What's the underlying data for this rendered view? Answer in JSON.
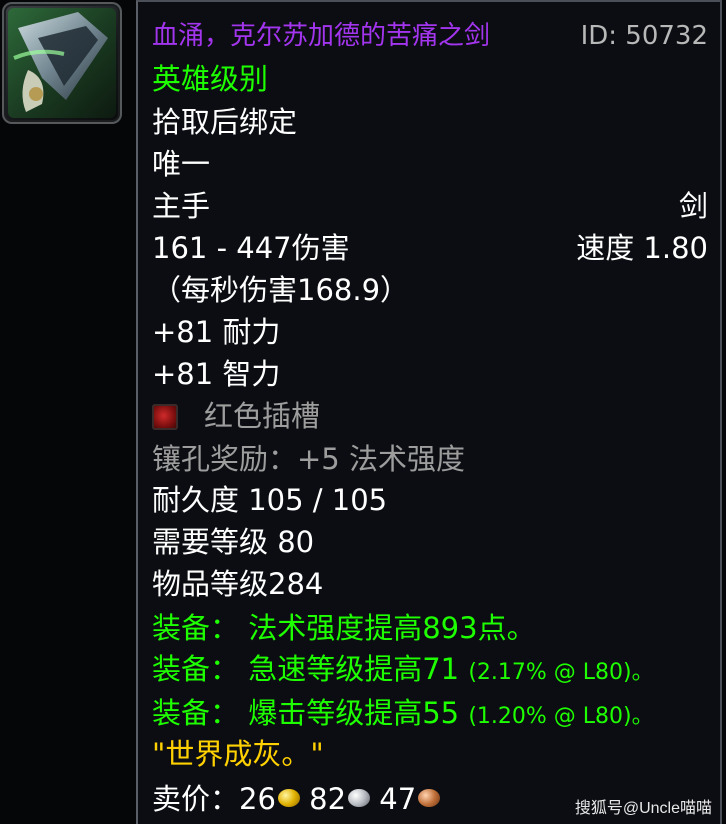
{
  "item": {
    "name": "血涌，克尔苏加德的苦痛之剑",
    "id_label": "ID: 50732",
    "difficulty": "英雄级别",
    "binding": "拾取后绑定",
    "uniqueness": "唯一",
    "slot": "主手",
    "type": "剑",
    "damage": "161 - 447伤害",
    "speed": "速度 1.80",
    "dps": "（每秒伤害168.9）",
    "stats": [
      "+81 耐力",
      "+81 智力"
    ],
    "socket": "红色插槽",
    "socket_bonus": "镶孔奖励：+5 法术强度",
    "durability": "耐久度 105 / 105",
    "required_level": "需要等级 80",
    "item_level": "物品等级284",
    "equip_effects": [
      {
        "text": "装备： 法术强度提高893点。",
        "note": ""
      },
      {
        "text": "装备： 急速等级提高71",
        "note": "(2.17% @ L80)。"
      },
      {
        "text": "装备： 爆击等级提高55",
        "note": "(1.20% @ L80)。"
      }
    ],
    "flavor": "\"世界成灰。\"",
    "sell_label": "卖价：",
    "sell_gold": "26",
    "sell_silver": "82",
    "sell_copper": "47"
  },
  "watermark": "搜狐号@Uncle喵喵",
  "colors": {
    "epic": "#a335ee",
    "uncommon_green": "#1eff00",
    "flavor_yellow": "#ffd100",
    "disabled_grey": "#9d9d9d"
  },
  "icons": {
    "item_icon": "sword-icon",
    "socket_icon": "red-socket-icon",
    "coins": [
      "gold-coin-icon",
      "silver-coin-icon",
      "copper-coin-icon"
    ]
  }
}
